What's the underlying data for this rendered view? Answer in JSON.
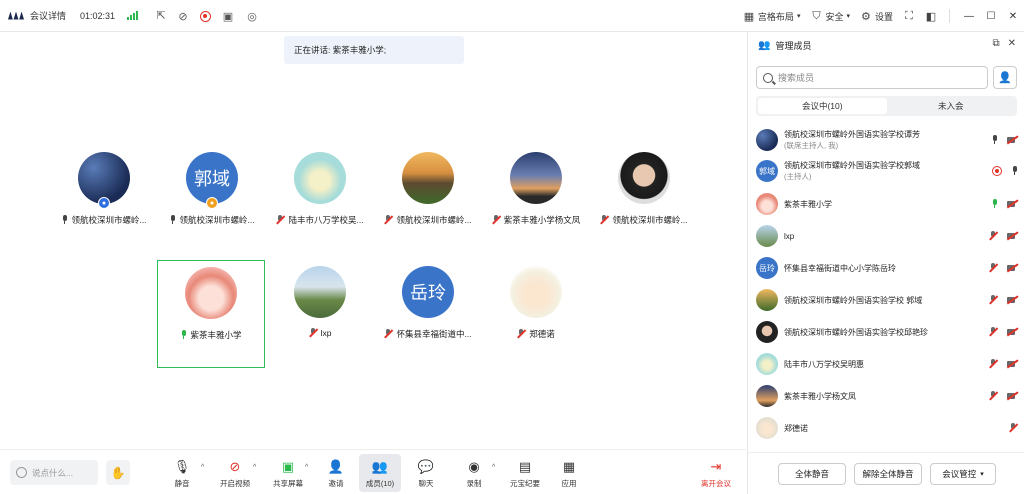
{
  "titlebar": {
    "meeting_details": "会议详情",
    "duration": "01:02:31",
    "layout": "宫格布局",
    "security": "安全",
    "settings": "设置"
  },
  "speaking": {
    "text": "正在讲话: 紫茶丰雅小学;"
  },
  "grid": [
    {
      "name": "领航校深圳市螺岭...",
      "mic": "on",
      "badge": "host"
    },
    {
      "name": "领航校深圳市螺岭...",
      "mic": "on",
      "badge": "cohost",
      "initials": "郭域"
    },
    {
      "name": "陆丰市八万学校吴...",
      "mic": "off"
    },
    {
      "name": "领航校深圳市螺岭...",
      "mic": "off"
    },
    {
      "name": "紫茶丰雅小学杨文凤",
      "mic": "off"
    },
    {
      "name": "领航校深圳市螺岭...",
      "mic": "off"
    },
    {
      "name": "紫茶丰雅小学",
      "mic": "speaking"
    },
    {
      "name": "lxp",
      "mic": "off"
    },
    {
      "name": "怀集县幸福街道中...",
      "mic": "off",
      "initials": "岳玲"
    },
    {
      "name": "郑德诺",
      "mic": "off"
    }
  ],
  "bottombar": {
    "chat_placeholder": "说点什么...",
    "mute": "静音",
    "video": "开启视频",
    "share": "共享屏幕",
    "invite": "邀请",
    "members": "成员(10)",
    "chat": "聊天",
    "record": "录制",
    "minutes": "元宝纪要",
    "apps": "应用",
    "leave": "离开会议"
  },
  "panel": {
    "title": "管理成员",
    "search_placeholder": "搜索成员",
    "tab_in": "会议中(10)",
    "tab_out": "未入会",
    "mute_all": "全体静音",
    "unmute_all": "解除全体静音",
    "control": "会议管控",
    "members": [
      {
        "name": "领航校深圳市螺岭外国语实验学校谭芳",
        "role": "(联席主持人, 我)",
        "mic": "grey",
        "cam": "off"
      },
      {
        "name": "领航校深圳市螺岭外国语实验学校郭域",
        "role": "(主持人)",
        "mic": "grey",
        "cam": "rec",
        "initials": "郭域"
      },
      {
        "name": "紫茶丰雅小学",
        "role": "",
        "mic": "green",
        "cam": "off"
      },
      {
        "name": "lxp",
        "role": "",
        "mic": "off",
        "cam": "off"
      },
      {
        "name": "怀集县幸福街道中心小学陈岳玲",
        "role": "",
        "mic": "off",
        "cam": "off",
        "initials": "岳玲"
      },
      {
        "name": "领航校深圳市螺岭外国语实验学校 郭域",
        "role": "",
        "mic": "off",
        "cam": "off"
      },
      {
        "name": "领航校深圳市螺岭外国语实验学校邱艳珍",
        "role": "",
        "mic": "off",
        "cam": "off"
      },
      {
        "name": "陆丰市八万学校吴明惠",
        "role": "",
        "mic": "off",
        "cam": "off"
      },
      {
        "name": "紫茶丰雅小学杨文凤",
        "role": "",
        "mic": "off",
        "cam": "off"
      },
      {
        "name": "郑德诺",
        "role": "",
        "mic": "off",
        "cam": "none"
      }
    ]
  }
}
